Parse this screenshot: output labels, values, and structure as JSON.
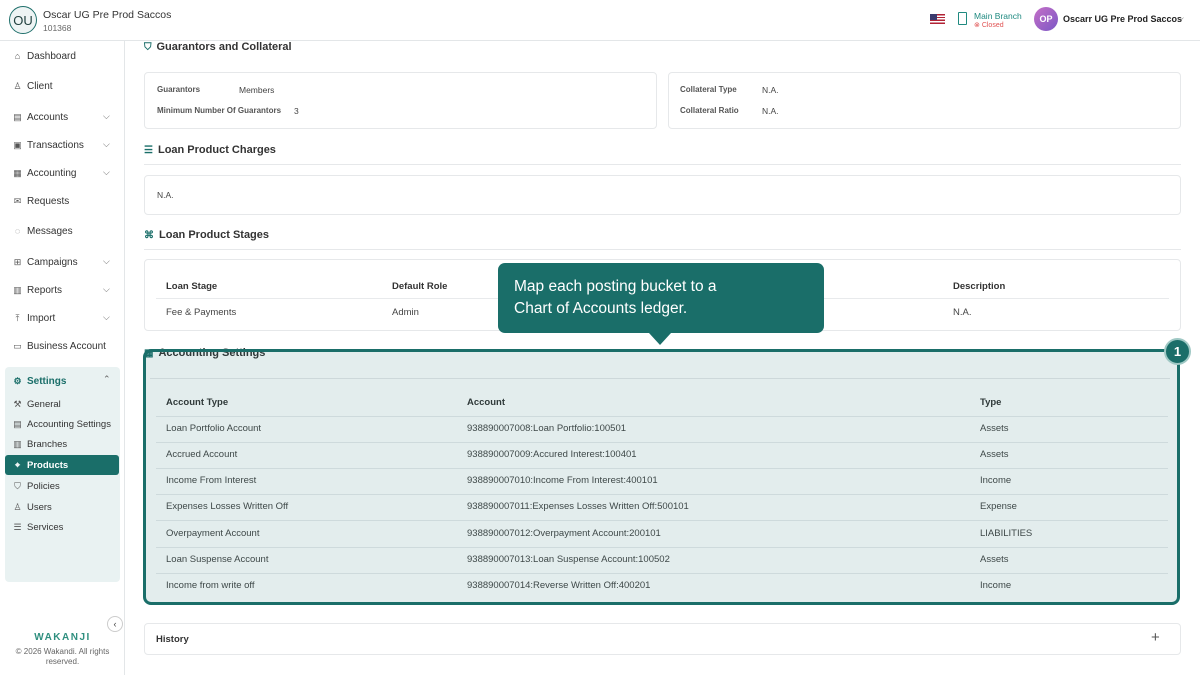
{
  "header": {
    "org_initials": "OU",
    "org_name": "Oscar UG Pre Prod Saccos",
    "org_id": "101368",
    "branch_name": "Main Branch",
    "branch_status": "Closed",
    "user_initials": "OP",
    "user_name": "Oscarr UG Pre Prod Saccos"
  },
  "sidebar": {
    "items": [
      {
        "label": "Dashboard",
        "icon": "home-icon"
      },
      {
        "label": "Client",
        "icon": "users-icon"
      },
      {
        "label": "Accounts",
        "icon": "wallet-icon"
      },
      {
        "label": "Transactions",
        "icon": "cash-icon"
      },
      {
        "label": "Accounting",
        "icon": "book-icon"
      },
      {
        "label": "Requests",
        "icon": "mail-icon"
      },
      {
        "label": "Messages",
        "icon": "chat-icon"
      },
      {
        "label": "Campaigns",
        "icon": "grid-icon"
      },
      {
        "label": "Reports",
        "icon": "chart-icon"
      },
      {
        "label": "Import",
        "icon": "upload-icon"
      },
      {
        "label": "Business Account",
        "icon": "briefcase-icon"
      }
    ],
    "settings_label": "Settings",
    "settings_items": [
      {
        "label": "General"
      },
      {
        "label": "Accounting Settings"
      },
      {
        "label": "Branches"
      },
      {
        "label": "Products"
      },
      {
        "label": "Policies"
      },
      {
        "label": "Users"
      },
      {
        "label": "Services"
      }
    ],
    "brand": "WAKANJI",
    "copyright": "© 2026 Wakandi. All rights reserved."
  },
  "guarantors": {
    "title": "Guarantors and Collateral",
    "guarantors_label": "Guarantors",
    "guarantors_value": "Members",
    "min_label": "Minimum Number Of Guarantors",
    "min_value": "3",
    "collateral_type_label": "Collateral Type",
    "collateral_type_value": "N.A.",
    "collateral_ratio_label": "Collateral Ratio",
    "collateral_ratio_value": "N.A."
  },
  "charges": {
    "title": "Loan Product Charges",
    "value": "N.A."
  },
  "stages": {
    "title": "Loan Product Stages",
    "headers": [
      "Loan Stage",
      "Default Role",
      "Description"
    ],
    "row": [
      "Fee & Payments",
      "Admin",
      "N.A."
    ]
  },
  "accounting": {
    "title": "Accounting Settings",
    "headers": [
      "Account Type",
      "Account",
      "Type"
    ],
    "rows": [
      [
        "Loan Portfolio Account",
        "938890007008:Loan Portfolio:100501",
        "Assets"
      ],
      [
        "Accrued Account",
        "938890007009:Accured Interest:100401",
        "Assets"
      ],
      [
        "Income From Interest",
        "938890007010:Income From Interest:400101",
        "Income"
      ],
      [
        "Expenses Losses Written Off",
        "938890007011:Expenses Losses Written Off:500101",
        "Expense"
      ],
      [
        "Overpayment Account",
        "938890007012:Overpayment Account:200101",
        "LIABILITIES"
      ],
      [
        "Loan Suspense Account",
        "938890007013:Loan Suspense Account:100502",
        "Assets"
      ],
      [
        "Income from write off",
        "938890007014:Reverse Written Off:400201",
        "Income"
      ]
    ]
  },
  "tooltip": {
    "line1": "Map each posting bucket to a",
    "line2": "Chart of Accounts ledger.",
    "step": "1"
  },
  "history": {
    "label": "History",
    "expand": "+"
  }
}
